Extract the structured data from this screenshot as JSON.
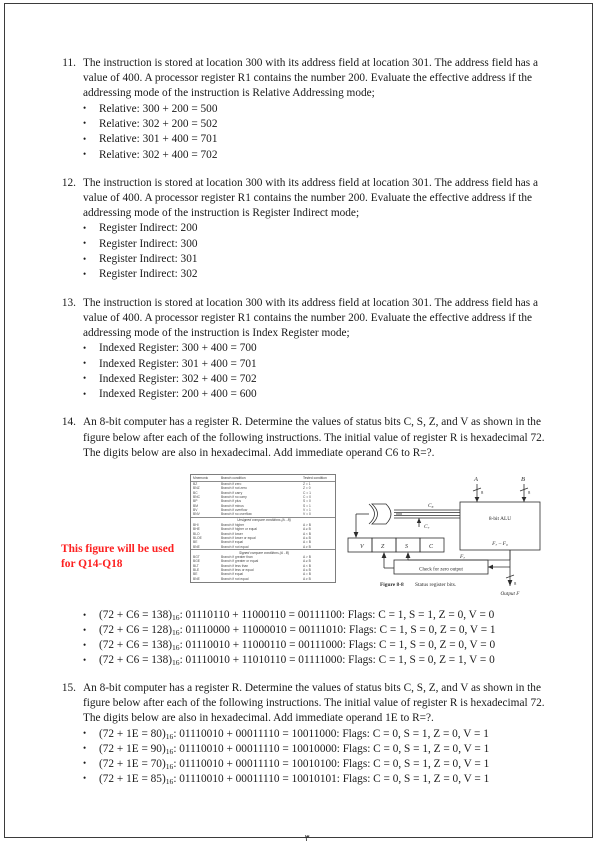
{
  "page": {
    "number": "٣"
  },
  "questions": [
    {
      "number": "11.",
      "text": "The instruction is stored at location 300 with its address field at location 301. The address field has a value of 400. A processor register R1 contains the number 200. Evaluate the effective address if the addressing mode of the instruction is Relative Addressing mode;",
      "bullets": [
        "Relative: 300 + 200 = 500",
        "Relative: 302 + 200 = 502",
        "Relative: 301 + 400 = 701",
        "Relative: 302 + 400 = 702"
      ]
    },
    {
      "number": "12.",
      "text": "The instruction is stored at location 300 with its address field at location 301. The address field has a value of 400. A processor register R1 contains the number 200. Evaluate the effective address if the addressing mode of the instruction is Register Indirect mode;",
      "bullets": [
        "Register Indirect: 200",
        "Register Indirect: 300",
        "Register Indirect: 301",
        "Register Indirect: 302"
      ]
    },
    {
      "number": "13.",
      "text": "The instruction is stored at location 300 with its address field at location 301. The address field has a value of 400. A processor register R1 contains the number 200. Evaluate the effective address if the addressing mode of the instruction is Index Register mode;",
      "bullets": [
        "Indexed Register: 300 + 400 = 700",
        "Indexed Register: 301 + 400 = 701",
        "Indexed Register: 302 + 400 = 702",
        "Indexed Register: 200 + 400 = 600"
      ]
    },
    {
      "number": "14.",
      "text": "An 8-bit computer has a register R. Determine the values of status bits C, S, Z, and V as shown in the figure below after each of the following instructions. The initial value of register R is hexadecimal 72. The digits below are also in hexadecimal. Add immediate operand C6 to R=?.",
      "bullets": [
        {
          "head": "(72 + C6 = 138)",
          "sub": "16",
          "tail": ": 01110110 + 11000110 = 00111100: Flags: C = 1, S = 1, Z = 0, V = 0"
        },
        {
          "head": "(72 + C6 = 128)",
          "sub": "16",
          "tail": ": 01110000 + 11000010 = 00111010: Flags: C = 1, S = 0, Z = 0, V = 1"
        },
        {
          "head": "(72 + C6 = 138)",
          "sub": "16",
          "tail": ": 01110010 + 11000110 = 00111000: Flags: C = 1, S = 0, Z = 0, V = 0"
        },
        {
          "head": "(72 + C6 = 138)",
          "sub": "16",
          "tail": ": 01110010 + 11010110 = 01111000: Flags: C = 1, S = 0, Z = 1, V = 0"
        }
      ]
    },
    {
      "number": "15.",
      "text": "An 8-bit computer has a register R. Determine the values of status bits C, S, Z, and V as shown in the figure below after each of the following instructions. The initial value of register R is hexadecimal 72. The digits below are also in hexadecimal. Add immediate operand 1E to R=?.",
      "bullets": [
        {
          "head": "(72 + 1E = 80)",
          "sub": "16",
          "tail": ": 01110010 + 00011110 = 10011000: Flags: C = 0, S = 1, Z = 0, V = 1"
        },
        {
          "head": "(72 + 1E = 90)",
          "sub": "16",
          "tail": ": 01110010 + 00011110 = 10010000: Flags: C = 0, S = 1, Z = 0, V = 1"
        },
        {
          "head": "(72 + 1E = 70)",
          "sub": "16",
          "tail": ": 01110010 + 00011110 = 10010100: Flags: C = 0, S = 1, Z = 0, V = 1"
        },
        {
          "head": "(72 + 1E = 85)",
          "sub": "16",
          "tail": ": 01110010 + 00011110 = 10010101: Flags: C = 0, S = 1, Z = 0, V = 1"
        }
      ]
    }
  ],
  "figure": {
    "note": "This figure will be used for Q14-Q18",
    "note_color": "#fd2020",
    "branch_table": {
      "headers": [
        "Mnemonic",
        "Branch condition",
        "Tested condition"
      ],
      "rows": [
        [
          "BZ",
          "Branch if zero",
          "Z = 1"
        ],
        [
          "BNZ",
          "Branch if not zero",
          "Z = 0"
        ],
        [
          "BC",
          "Branch if carry",
          "C = 1"
        ],
        [
          "BNC",
          "Branch if no carry",
          "C = 0"
        ],
        [
          "BP",
          "Branch if plus",
          "S = 0"
        ],
        [
          "BM",
          "Branch if minus",
          "S = 1"
        ],
        [
          "BV",
          "Branch if overflow",
          "V = 1"
        ],
        [
          "BNV",
          "Branch if no overflow",
          "V = 0"
        ]
      ],
      "section_unsigned": "Unsigned compare conditions (A - B)",
      "rows_unsigned": [
        [
          "BHI",
          "Branch if higher",
          "A > B"
        ],
        [
          "BHE",
          "Branch if higher or equal",
          "A ≥ B"
        ],
        [
          "BLO",
          "Branch if lower",
          "A < B"
        ],
        [
          "BLOE",
          "Branch if lower or equal",
          "A ≤ B"
        ],
        [
          "BE",
          "Branch if equal",
          "A = B"
        ],
        [
          "BNE",
          "Branch if not equal",
          "A ≠ B"
        ]
      ],
      "section_signed": "Signed compare conditions (A - B)",
      "rows_signed": [
        [
          "BGT",
          "Branch if greater than",
          "A > B"
        ],
        [
          "BGE",
          "Branch if greater or equal",
          "A ≥ B"
        ],
        [
          "BLT",
          "Branch if less than",
          "A < B"
        ],
        [
          "BLE",
          "Branch if less or equal",
          "A ≤ B"
        ],
        [
          "BE",
          "Branch if equal",
          "A = B"
        ],
        [
          "BNE",
          "Branch if not equal",
          "A ≠ B"
        ]
      ]
    },
    "alu_diagram": {
      "input_a": "A",
      "input_b": "B",
      "bus_width_a": "8",
      "bus_width_b": "8",
      "alu_label": "8-bit ALU",
      "alu_output_label": "F₇ – F₀",
      "carry_c8": "C₈",
      "carry_c7": "C₇",
      "status_bits": [
        "V",
        "Z",
        "S",
        "C"
      ],
      "sign_line": "F₇",
      "zero_check_label": "Check for zero output",
      "output_bus_width": "8",
      "output_label": "Output F",
      "caption_number": "Figure 8-8",
      "caption_text": "Status register bits."
    }
  }
}
